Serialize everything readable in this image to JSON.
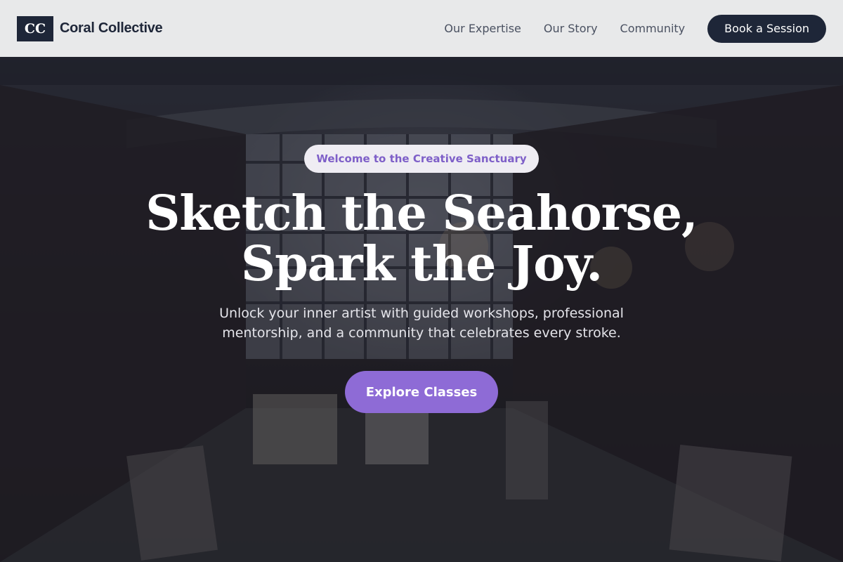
{
  "header": {
    "logo_mark": "CC",
    "brand_name": "Coral Collective",
    "nav": [
      {
        "label": "Our Expertise"
      },
      {
        "label": "Our Story"
      },
      {
        "label": "Community"
      }
    ],
    "cta_label": "Book a Session"
  },
  "hero": {
    "eyebrow": "Welcome to the Creative Sanctuary",
    "headline_line1": "Sketch the Seahorse,",
    "headline_line2": "Spark the Joy.",
    "subcopy": "Unlock your inner artist with guided workshops, professional mentorship, and a community that celebrates every stroke.",
    "cta_label": "Explore Classes",
    "background_image": "art-studio-workshop-photo"
  },
  "colors": {
    "navy": "#1e2638",
    "accent_purple": "#8e6bd6",
    "eyebrow_text": "#7e5fc8",
    "header_bg": "#e8e9ea"
  }
}
